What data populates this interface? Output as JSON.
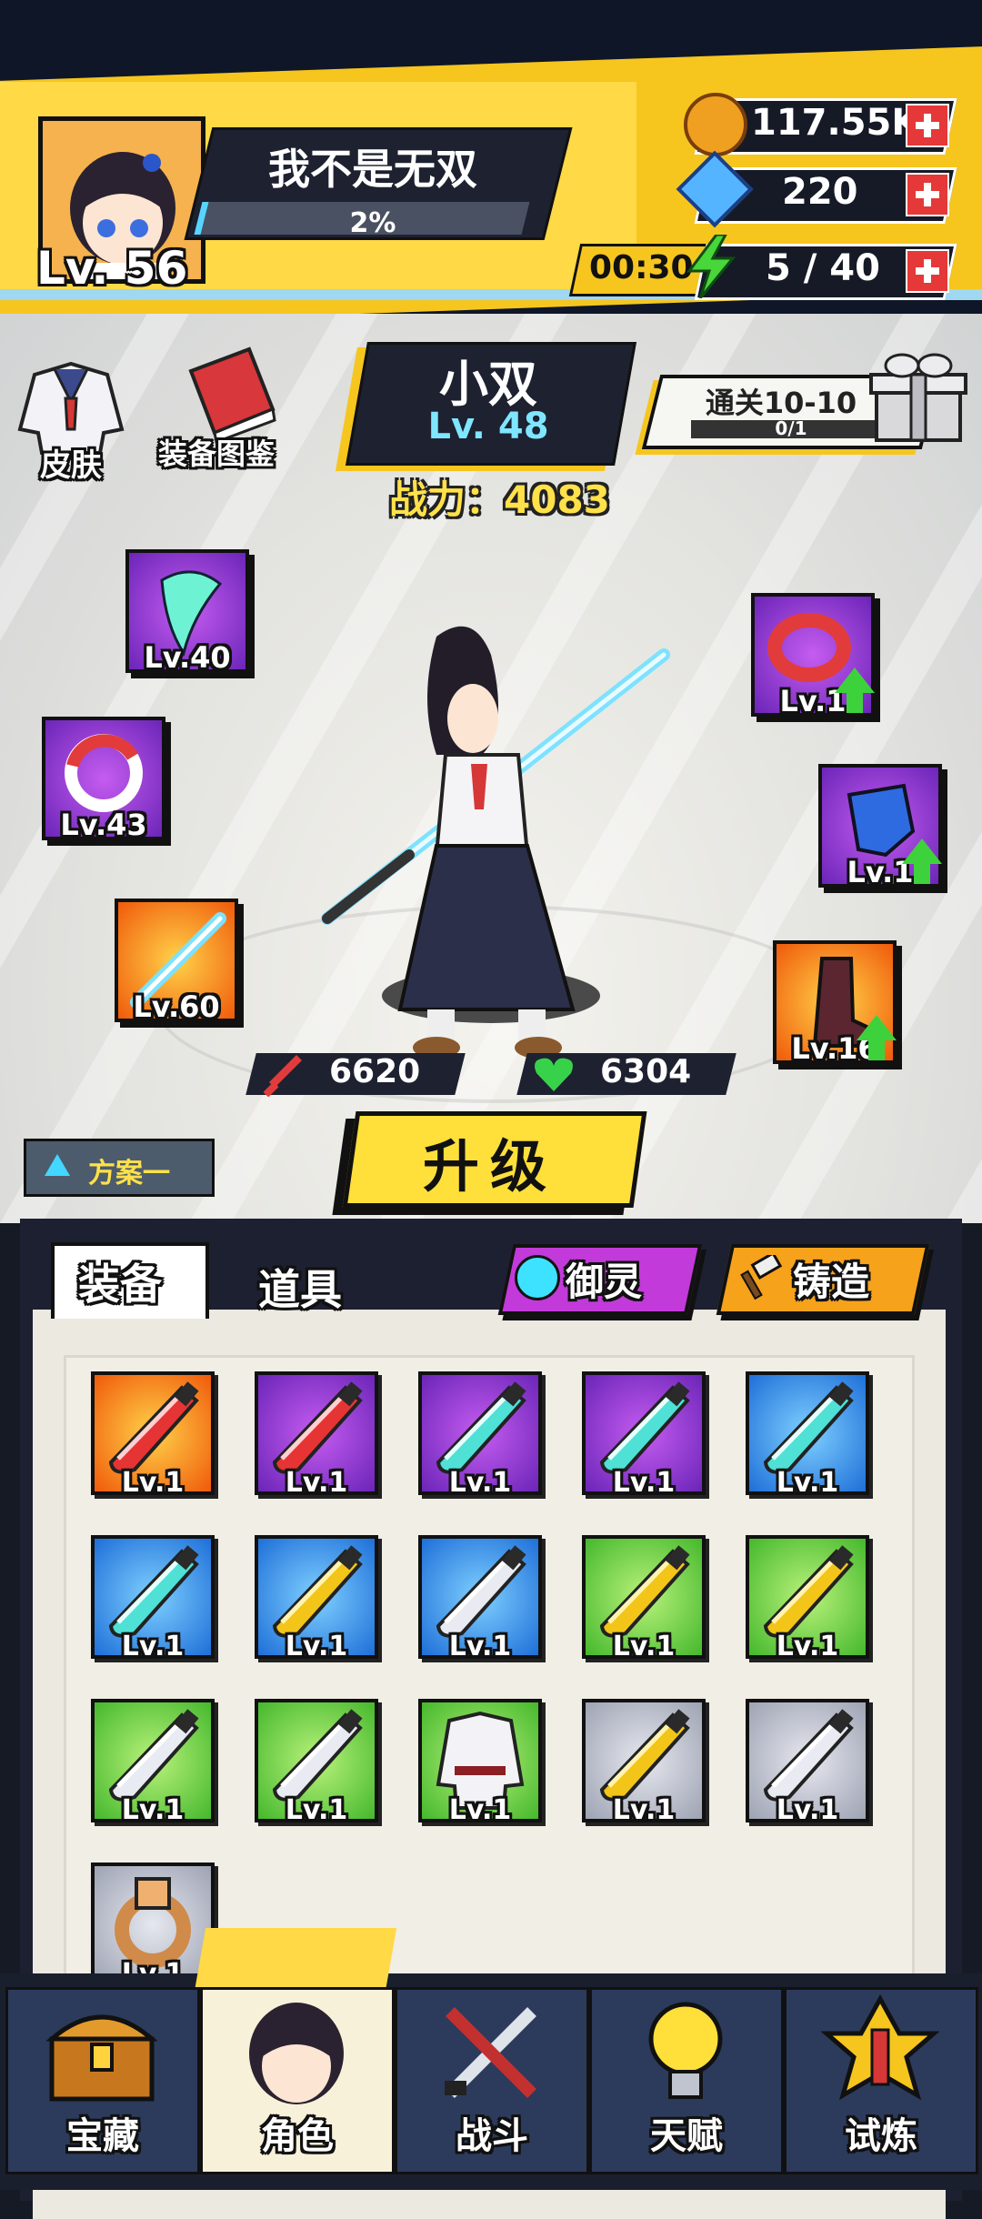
{
  "player": {
    "name": "我不是无双",
    "level": "Lv. 56",
    "progress": "2%"
  },
  "resources": {
    "coins": "117.55K",
    "gems": "220",
    "energy_timer": "00:30",
    "energy": "5 / 40"
  },
  "top_buttons": {
    "skin": "皮肤",
    "codex": "装备图鉴"
  },
  "character": {
    "name": "小双",
    "level": "Lv. 48",
    "power_label": "战力：",
    "power": "4083"
  },
  "quest": {
    "title": "通关10-10",
    "progress": "0/1"
  },
  "equip_slots": {
    "left": [
      {
        "name": "necklace",
        "level": "Lv.40",
        "rarity": "purple"
      },
      {
        "name": "ring",
        "level": "Lv.43",
        "rarity": "purple"
      },
      {
        "name": "weapon",
        "level": "Lv.60",
        "rarity": "orange"
      }
    ],
    "right": [
      {
        "name": "belt",
        "level": "Lv.1",
        "rarity": "purple"
      },
      {
        "name": "gloves",
        "level": "Lv.1",
        "rarity": "purple"
      },
      {
        "name": "boots",
        "level": "Lv.16",
        "rarity": "orange"
      }
    ]
  },
  "stats": {
    "attack": "6620",
    "hp": "6304"
  },
  "upgrade_button": "升级",
  "plan_selector": "方案一",
  "inventory": {
    "tabs": [
      "装备",
      "道具"
    ],
    "active_tab": "装备",
    "actions": {
      "spirit": "御灵",
      "forge": "铸造"
    },
    "items": [
      {
        "rarity": "orange",
        "type": "machete-red",
        "level": "Lv.1"
      },
      {
        "rarity": "purple",
        "type": "machete-red",
        "level": "Lv.1"
      },
      {
        "rarity": "purple",
        "type": "cleaver-teal",
        "level": "Lv.1"
      },
      {
        "rarity": "purple",
        "type": "cleaver-teal",
        "level": "Lv.1"
      },
      {
        "rarity": "blue",
        "type": "cleaver-teal",
        "level": "Lv.1"
      },
      {
        "rarity": "blue",
        "type": "cleaver-teal",
        "level": "Lv.1"
      },
      {
        "rarity": "blue",
        "type": "machete-gold",
        "level": "Lv.1"
      },
      {
        "rarity": "blue",
        "type": "machete-white",
        "level": "Lv.1"
      },
      {
        "rarity": "green",
        "type": "machete-gold",
        "level": "Lv.1"
      },
      {
        "rarity": "green",
        "type": "machete-gold",
        "level": "Lv.1"
      },
      {
        "rarity": "green",
        "type": "machete-white",
        "level": "Lv.1"
      },
      {
        "rarity": "green",
        "type": "machete-white",
        "level": "Lv.1"
      },
      {
        "rarity": "green",
        "type": "uniform",
        "level": "Lv.1"
      },
      {
        "rarity": "grey",
        "type": "machete-gold",
        "level": "Lv.1"
      },
      {
        "rarity": "grey",
        "type": "machete-white",
        "level": "Lv.1"
      },
      {
        "rarity": "grey",
        "type": "ring-bronze",
        "level": "Lv.1"
      }
    ]
  },
  "nav": [
    {
      "label": "宝藏",
      "icon": "treasure-chest-icon"
    },
    {
      "label": "角色",
      "icon": "character-avatar-icon"
    },
    {
      "label": "战斗",
      "icon": "crossed-swords-icon"
    },
    {
      "label": "天赋",
      "icon": "lightbulb-icon"
    },
    {
      "label": "试炼",
      "icon": "trial-emblem-icon"
    }
  ],
  "colors": {
    "accent_yellow": "#f6c61f",
    "dark_navy": "#161a24",
    "plus_red": "#e53838",
    "energy_green": "#3dd23b"
  }
}
